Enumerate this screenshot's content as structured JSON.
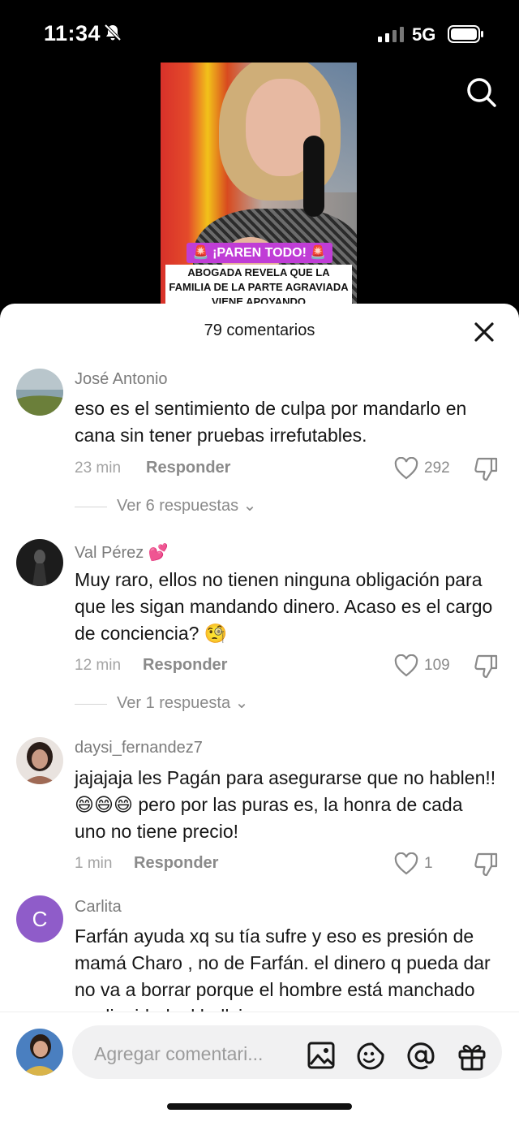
{
  "status": {
    "time": "11:34",
    "network": "5G"
  },
  "video": {
    "banner": "🚨 ¡PAREN TODO! 🚨",
    "caption": "ABOGADA REVELA QUE LA FAMILIA DE LA PARTE AGRAVIADA VIENE APOYANDO"
  },
  "comments_panel": {
    "count_label": "79 comentarios",
    "comments": [
      {
        "username": "José Antonio",
        "text": "eso es el sentimiento de culpa por mandarlo en cana sin tener pruebas irrefutables.",
        "time": "23 min",
        "reply_label": "Responder",
        "likes": "292",
        "replies_label": "Ver 6 respuestas"
      },
      {
        "username": "Val Pérez 💕",
        "text": "Muy raro, ellos no tienen ninguna obligación para que les sigan mandando dinero. Acaso es el cargo de conciencia? 🧐",
        "time": "12 min",
        "reply_label": "Responder",
        "likes": "109",
        "replies_label": "Ver 1 respuesta"
      },
      {
        "username": "daysi_fernandez7",
        "text": "jajajaja les Pagán para asegurarse que no hablen!! 😄😄😄 pero por las puras es, la honra de cada uno no tiene precio!",
        "time": "1 min",
        "reply_label": "Responder",
        "likes": "1"
      },
      {
        "username": "Carlita",
        "avatar_letter": "C",
        "text": "Farfán ayuda xq su tía sufre y eso es presión de mamá Charo , no de Farfán. el dinero q pueda dar no va a borrar porque el hombre está manchado su dignidad, el bullying q"
      }
    ]
  },
  "composer": {
    "placeholder": "Agregar comentari..."
  },
  "colors": {
    "avatar_purple": "#8f5cc9",
    "text": "#161616",
    "muted": "#8a8a8a"
  }
}
